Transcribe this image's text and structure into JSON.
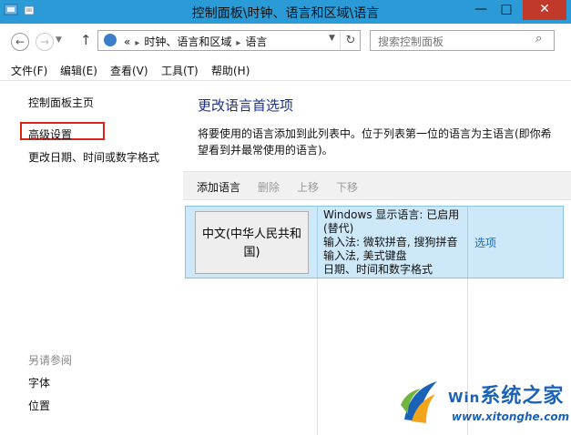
{
  "window": {
    "title": "控制面板\\时钟、语言和区域\\语言",
    "minimize": "—",
    "maximize": "□",
    "close": "✕"
  },
  "address": {
    "overflow": "«",
    "crumbs": [
      "时钟、语言和区域",
      "语言"
    ],
    "separator": "▸",
    "search_placeholder": "搜索控制面板"
  },
  "menu": [
    "文件(F)",
    "编辑(E)",
    "查看(V)",
    "工具(T)",
    "帮助(H)"
  ],
  "sidebar": {
    "home": "控制面板主页",
    "advanced": "高级设置",
    "date_time": "更改日期、时间或数字格式",
    "see_also": "另请参阅",
    "fonts": "字体",
    "location": "位置"
  },
  "main": {
    "title": "更改语言首选项",
    "description": "将要使用的语言添加到此列表中。位于列表第一位的语言为主语言(即你希望看到并最常使用的语言)。",
    "toolbar": {
      "add": "添加语言",
      "remove": "删除",
      "up": "上移",
      "down": "下移"
    },
    "language": {
      "name": "中文(中华人民共和国)",
      "info_line1": "Windows 显示语言: 已启用(替代)",
      "info_line2": "输入法: 微软拼音, 搜狗拼音输入法, 美式键盘",
      "info_line3": "日期、时间和数字格式",
      "options": "选项"
    }
  },
  "watermark": {
    "text": "系统之家",
    "prefix": "Win",
    "url": "www.xitonghe.com"
  },
  "colors": {
    "titlebar": "#2a9bd6",
    "close": "#c0392b",
    "highlight_border": "#d9241c",
    "title_blue": "#1e3287",
    "selected_row": "#cde8f8",
    "link_blue": "#1a6bc0"
  }
}
